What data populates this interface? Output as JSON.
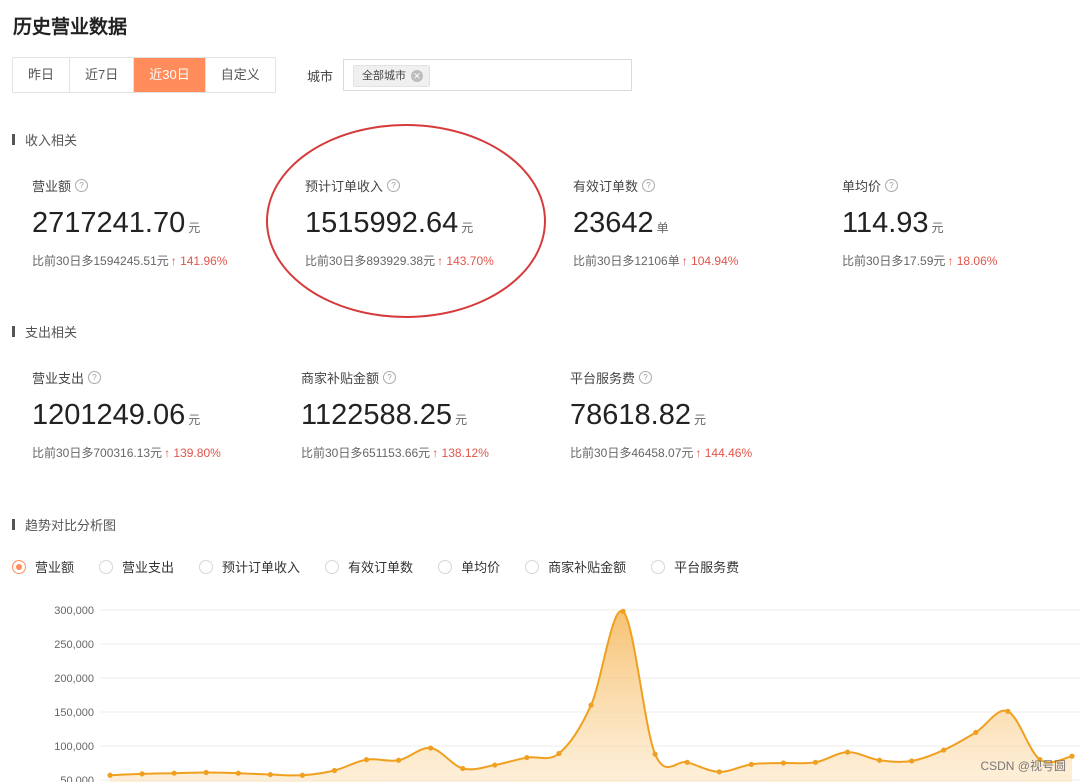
{
  "page_title": "历史营业数据",
  "tabs": [
    {
      "label": "昨日",
      "active": false
    },
    {
      "label": "近7日",
      "active": false
    },
    {
      "label": "近30日",
      "active": true
    },
    {
      "label": "自定义",
      "active": false
    }
  ],
  "city": {
    "label": "城市",
    "tag": "全部城市"
  },
  "income_section": {
    "title": "收入相关",
    "metrics": [
      {
        "label": "营业额",
        "value": "2717241.70",
        "unit": "元",
        "compare": "比前30日多1594245.51元",
        "pct": "↑ 141.96%"
      },
      {
        "label": "预计订单收入",
        "value": "1515992.64",
        "unit": "元",
        "compare": "比前30日多893929.38元",
        "pct": "↑ 143.70%"
      },
      {
        "label": "有效订单数",
        "value": "23642",
        "unit": "单",
        "compare": "比前30日多12106单",
        "pct": "↑ 104.94%"
      },
      {
        "label": "单均价",
        "value": "114.93",
        "unit": "元",
        "compare": "比前30日多17.59元",
        "pct": "↑ 18.06%"
      }
    ]
  },
  "expense_section": {
    "title": "支出相关",
    "metrics": [
      {
        "label": "营业支出",
        "value": "1201249.06",
        "unit": "元",
        "compare": "比前30日多700316.13元",
        "pct": "↑ 139.80%"
      },
      {
        "label": "商家补贴金额",
        "value": "1122588.25",
        "unit": "元",
        "compare": "比前30日多651153.66元",
        "pct": "↑ 138.12%"
      },
      {
        "label": "平台服务费",
        "value": "78618.82",
        "unit": "元",
        "compare": "比前30日多46458.07元",
        "pct": "↑ 144.46%"
      }
    ]
  },
  "trend_section": {
    "title": "趋势对比分析图",
    "options": [
      {
        "label": "营业额",
        "checked": true
      },
      {
        "label": "营业支出",
        "checked": false
      },
      {
        "label": "预计订单收入",
        "checked": false
      },
      {
        "label": "有效订单数",
        "checked": false
      },
      {
        "label": "单均价",
        "checked": false
      },
      {
        "label": "商家补贴金额",
        "checked": false
      },
      {
        "label": "平台服务费",
        "checked": false
      }
    ]
  },
  "chart_data": {
    "type": "area",
    "title": "",
    "xlabel": "",
    "ylabel": "",
    "ylim": [
      50000,
      300000
    ],
    "y_ticks": [
      "50,000",
      "100,000",
      "150,000",
      "200,000",
      "250,000",
      "300,000"
    ],
    "grid": true,
    "color": "#f0a020",
    "series": [
      {
        "values": [
          57000,
          59000,
          60000,
          61000,
          60000,
          58000,
          57000,
          64000,
          80000,
          79000,
          97000,
          67000,
          72000,
          83000,
          89000,
          160000,
          298000,
          88000,
          76000,
          62000,
          73000,
          75000,
          76000,
          91000,
          79000,
          78000,
          94000,
          120000,
          151000,
          80000,
          85000
        ]
      }
    ]
  },
  "watermark": "CSDN @视号圆"
}
